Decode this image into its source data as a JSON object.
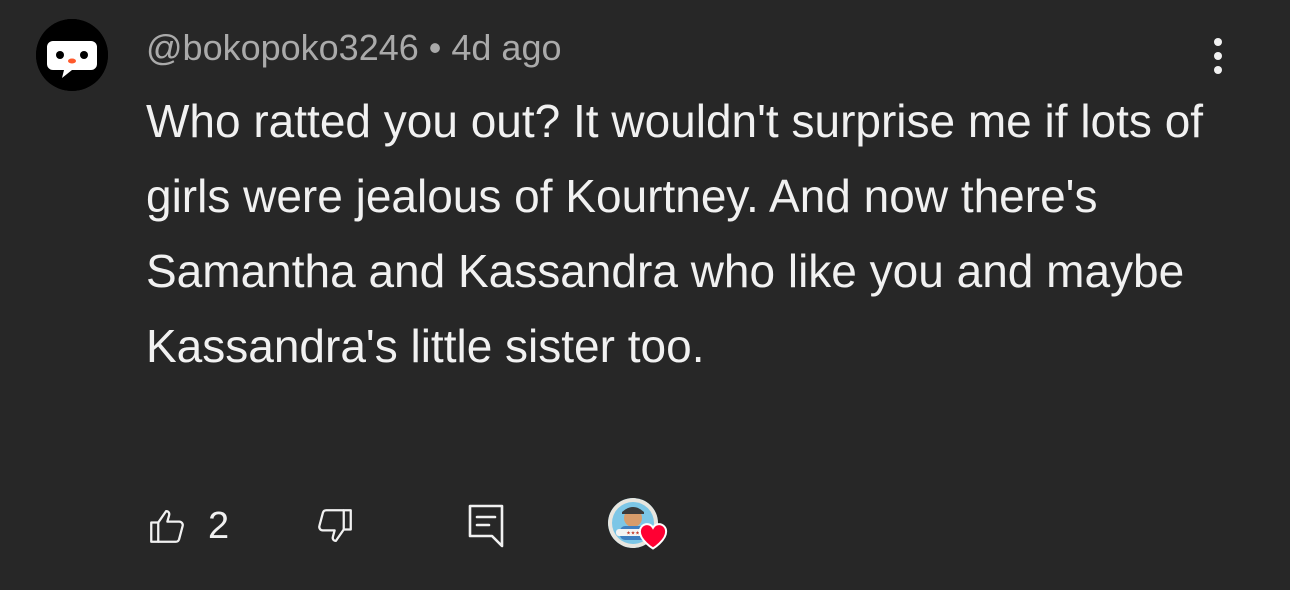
{
  "comment": {
    "author": "@bokopoko3246",
    "separator": "•",
    "time": "4d ago",
    "text": "Who ratted you out? It wouldn't surprise me if lots of girls were jealous of Kourtney. And now there's Samantha and Kassandra who like you and maybe Kassandra's little sister too.",
    "like_count": "2"
  },
  "icons": {
    "avatar": "ghost-face-avatar",
    "more": "more-vertical-icon",
    "like": "thumbs-up-icon",
    "dislike": "thumbs-down-icon",
    "reply": "reply-icon",
    "creator_heart": "creator-heart-badge"
  },
  "colors": {
    "background": "#272727",
    "text": "#f1f1f1",
    "meta_text": "#aaaaaa",
    "heart": "#ff0033"
  }
}
